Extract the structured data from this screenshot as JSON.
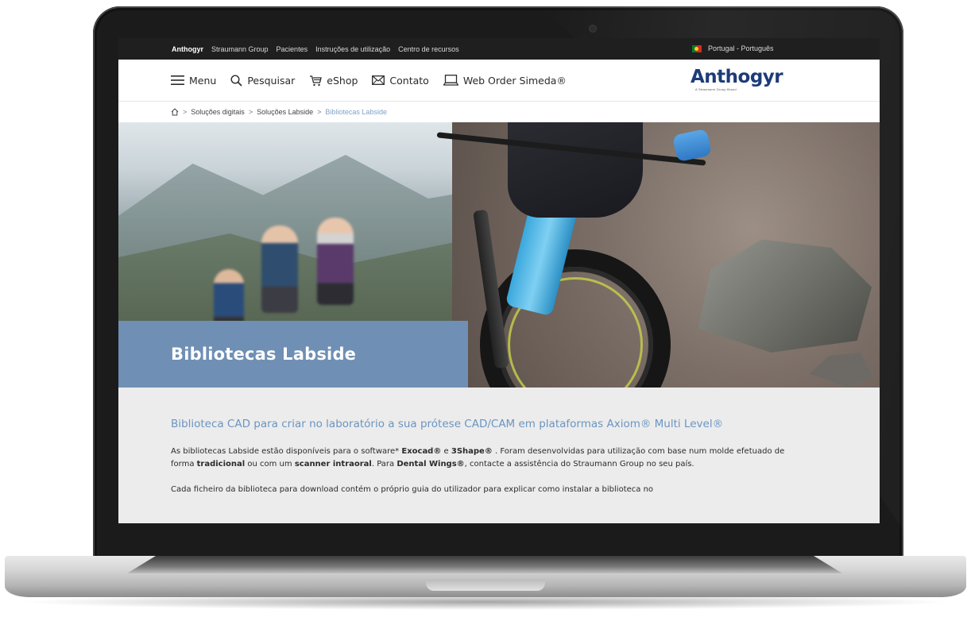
{
  "topbar": {
    "links": [
      "Anthogyr",
      "Straumann Group",
      "Pacientes",
      "Instruções de utilização",
      "Centro de recursos"
    ],
    "language": "Portugal - Português"
  },
  "nav": {
    "menu": "Menu",
    "search": "Pesquisar",
    "eshop": "eShop",
    "contact": "Contato",
    "web_order": "Web Order Simeda®"
  },
  "logo": {
    "wordmark": "Anthogyr",
    "tagline": "A Straumann Group Brand"
  },
  "breadcrumb": {
    "items": [
      "Soluções digitais",
      "Soluções Labside"
    ],
    "current": "Bibliotecas Labside"
  },
  "hero": {
    "title": "Bibliotecas Labside"
  },
  "content": {
    "heading": "Biblioteca CAD para criar no laboratório a sua prótese CAD/CAM em plataformas Axiom® Multi Level®",
    "p1": {
      "t1": "As bibliotecas Labside estão disponíveis para o software* ",
      "b1": "Exocad®",
      "t2": " e ",
      "b2": "3Shape®",
      "t3": " . Foram desenvolvidas para utilização com base num molde efetuado de forma ",
      "b3": "tradicional",
      "t4": " ou com um ",
      "b4": "scanner intraoral",
      "t5": ". Para ",
      "b5": "Dental Wings®",
      "t6": ", contacte a assistência do Straumann Group no seu país."
    },
    "p2": "Cada ficheiro da biblioteca para download contém o próprio guia do utilizador para explicar como instalar a biblioteca no"
  },
  "colors": {
    "accent": "#6a95c2",
    "hero_box": "#6f8fb4",
    "logo": "#1d3b78",
    "topbar": "#1f1f1f"
  }
}
